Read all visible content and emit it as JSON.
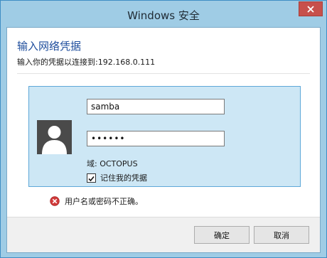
{
  "window": {
    "title": "Windows 安全"
  },
  "dialog": {
    "heading": "输入网络凭据",
    "subheading": "输入你的凭据以连接到:192.168.0.111"
  },
  "credentials": {
    "username_value": "samba",
    "password_value": "••••••",
    "domain_label": "域: OCTOPUS",
    "remember_label": "记住我的凭据",
    "remember_checked": true
  },
  "error": {
    "message": "用户名或密码不正确。",
    "icon": "error-icon"
  },
  "buttons": {
    "ok_label": "确定",
    "cancel_label": "取消"
  },
  "colors": {
    "frame": "#9fcce5",
    "heading": "#1e4d9c",
    "tile": "#cde7f5",
    "close": "#c7504b",
    "error": "#d23b3b"
  }
}
